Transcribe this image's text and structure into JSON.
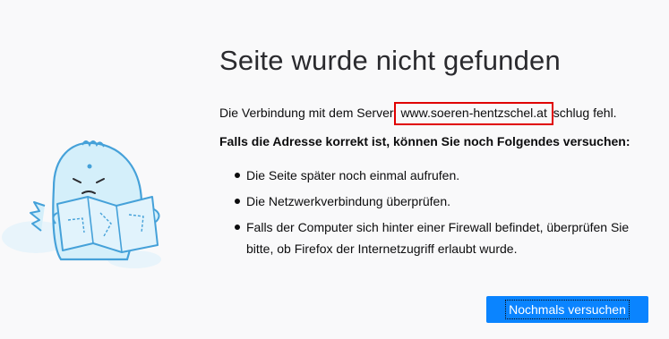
{
  "error_page": {
    "title": "Seite wurde nicht gefunden",
    "description_prefix": "Die Verbindung mit dem Server ",
    "host": "www.soeren-hentzschel.at",
    "description_suffix": " schlug fehl.",
    "subheading": "Falls die Adresse korrekt ist, können Sie noch Folgendes versuchen:",
    "tips": [
      "Die Seite später noch einmal aufrufen.",
      "Die Netzwerkverbindung überprüfen.",
      "Falls der Computer sich hinter einer Firewall befindet, überprüfen Sie bitte, ob Firefox der Internetzugriff erlaubt wurde."
    ],
    "retry_label": "Nochmals versuchen"
  },
  "colors": {
    "accent": "#0a84ff",
    "highlight_box": "#e00000",
    "background": "#f9f9fa"
  },
  "icons": {
    "illustration": "confused-dinosaur-with-map-illustration"
  }
}
